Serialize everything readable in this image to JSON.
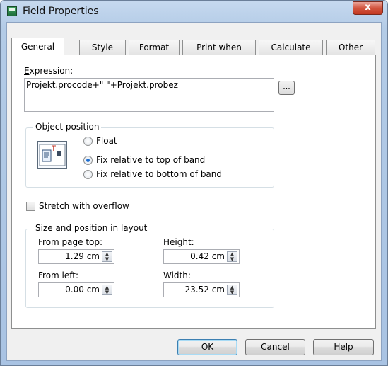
{
  "window": {
    "title": "Field Properties",
    "close_glyph": "x"
  },
  "tabs": [
    {
      "label": "General"
    },
    {
      "label": "Style"
    },
    {
      "label": "Format"
    },
    {
      "label": "Print when"
    },
    {
      "label": "Calculate"
    },
    {
      "label": "Other"
    }
  ],
  "expression": {
    "label": "Expression:",
    "value": "Projekt.procode+\" \"+Projekt.probez",
    "button": "..."
  },
  "object_position": {
    "title": "Object position",
    "options": [
      {
        "label": "Float",
        "selected": false
      },
      {
        "label": "Fix relative to top of band",
        "selected": true
      },
      {
        "label": "Fix relative to bottom of band",
        "selected": false
      }
    ]
  },
  "stretch": {
    "label": "Stretch with overflow",
    "checked": false
  },
  "layout": {
    "title": "Size and position in layout",
    "from_top_label": "From page top:",
    "from_top_value": "1.29 cm",
    "height_label": "Height:",
    "height_value": "0.42 cm",
    "from_left_label": "From left:",
    "from_left_value": "0.00 cm",
    "width_label": "Width:",
    "width_value": "23.52 cm"
  },
  "buttons": {
    "ok": "OK",
    "cancel": "Cancel",
    "help": "Help"
  },
  "icons": [
    "app-icon",
    "close-icon",
    "object-position-icon",
    "spin-arrows-icon"
  ]
}
